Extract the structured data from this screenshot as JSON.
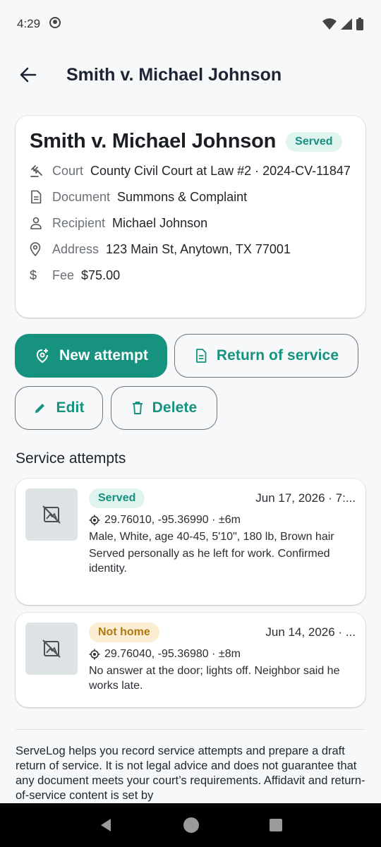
{
  "status": {
    "time": "4:29"
  },
  "header": {
    "title": "Smith v. Michael Johnson"
  },
  "case": {
    "title": "Smith v. Michael Johnson",
    "status": "Served",
    "court_label": "Court",
    "court_value": "County Civil Court at Law #2 · 2024-CV-11847",
    "document_label": "Document",
    "document_value": "Summons & Complaint",
    "recipient_label": "Recipient",
    "recipient_value": "Michael Johnson",
    "address_label": "Address",
    "address_value": "123 Main St, Anytown, TX 77001",
    "fee_label": "Fee",
    "fee_value": "$75.00"
  },
  "actions": {
    "new_attempt": "New attempt",
    "return_of_service": "Return of service",
    "edit": "Edit",
    "delete": "Delete"
  },
  "attempts_section": {
    "title": "Service attempts"
  },
  "attempts": [
    {
      "status": "Served",
      "date": "Jun 17, 2026 · 7:...",
      "coords": "29.76010, -95.36990 · ±6m",
      "description": "Male, White, age 40-45, 5'10\", 180 lb, Brown hair",
      "notes": "Served personally as he left for work. Confirmed identity."
    },
    {
      "status": "Not home",
      "date": "Jun 14, 2026 · ...",
      "coords": "29.76040, -95.36980 · ±8m",
      "notes": "No answer at the door; lights off. Neighbor said he works late."
    }
  ],
  "disclaimer": "ServeLog helps you record service attempts and prepare a draft return of service. It is not legal advice and does not guarantee that any document meets your court’s requirements. Affidavit and return-of-service content is set by",
  "colors": {
    "accent": "#17927f",
    "served_bg": "#dff3ef",
    "not_home_bg": "#fdeed3",
    "not_home_text": "#b07812"
  },
  "icons": {
    "gavel": "gavel-icon",
    "document": "document-icon",
    "person": "person-icon",
    "location": "location-pin-icon",
    "dollar": "dollar-icon",
    "gps": "gps-icon",
    "no_photo": "no-photo-icon"
  }
}
